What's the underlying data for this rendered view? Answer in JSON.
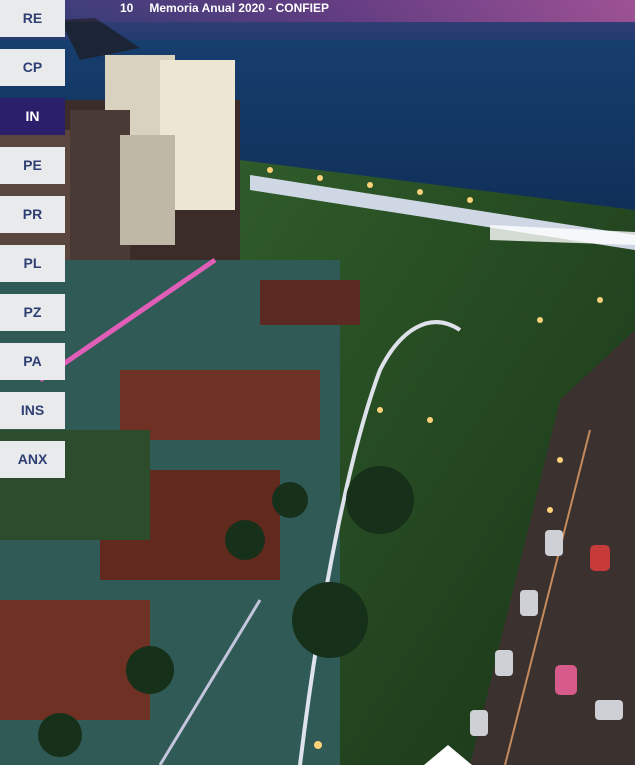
{
  "header": {
    "page_number": "10",
    "title": "Memoria Anual 2020 - CONFIEP"
  },
  "nav": {
    "items": [
      {
        "label": "RE",
        "active": false
      },
      {
        "label": "CP",
        "active": false
      },
      {
        "label": "IN",
        "active": true
      },
      {
        "label": "PE",
        "active": false
      },
      {
        "label": "PR",
        "active": false
      },
      {
        "label": "PL",
        "active": false
      },
      {
        "label": "PZ",
        "active": false
      },
      {
        "label": "PA",
        "active": false
      },
      {
        "label": "INS",
        "active": false
      },
      {
        "label": "ANX",
        "active": false
      }
    ]
  },
  "colors": {
    "nav_bg": "#e9eaec",
    "nav_text": "#2e3f73",
    "nav_active_bg": "#2b1f6b",
    "nav_active_text": "#ffffff"
  }
}
